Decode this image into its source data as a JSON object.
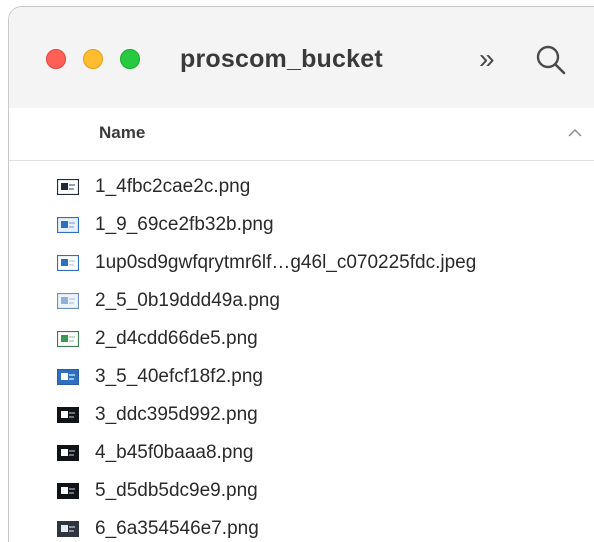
{
  "window": {
    "title": "proscom_bucket",
    "more_glyph": "»"
  },
  "icons": {
    "close": "close-button",
    "minimize": "minimize-button",
    "maximize": "zoom-button",
    "overflow": "chevron-double-right-icon",
    "search": "search-icon",
    "sort": "chevron-up-icon",
    "file": "image-file-icon"
  },
  "colors": {
    "close": "#ff5f57",
    "minimize": "#febc2e",
    "maximize": "#28c840"
  },
  "columns": {
    "name": "Name"
  },
  "files": [
    {
      "name": "1_4fbc2cae2c.png",
      "thumb": "dark"
    },
    {
      "name": "1_9_69ce2fb32b.png",
      "thumb": "blue"
    },
    {
      "name": "1up0sd9gwfqrytmr6lf…g46l_c070225fdc.jpeg",
      "thumb": "blue-outline"
    },
    {
      "name": "2_5_0b19ddd49a.png",
      "thumb": "light-blue"
    },
    {
      "name": "2_d4cdd66de5.png",
      "thumb": "green"
    },
    {
      "name": "3_5_40efcf18f2.png",
      "thumb": "blue-fill"
    },
    {
      "name": "3_ddc395d992.png",
      "thumb": "black"
    },
    {
      "name": "4_b45f0baaa8.png",
      "thumb": "black"
    },
    {
      "name": "5_d5db5dc9e9.png",
      "thumb": "black"
    },
    {
      "name": "6_6a354546e7.png",
      "thumb": "dark-grey"
    }
  ]
}
